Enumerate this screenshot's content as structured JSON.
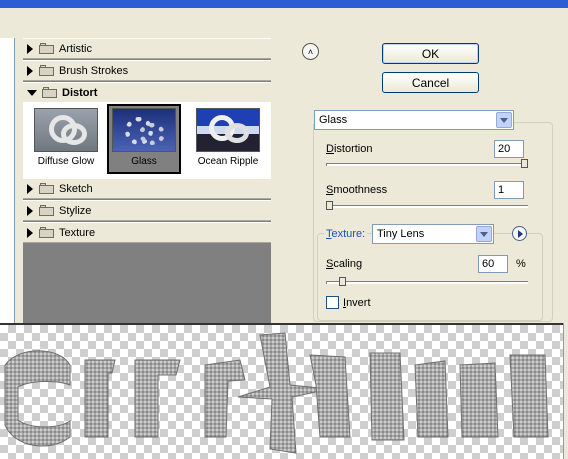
{
  "filter_categories_top": [
    {
      "label": "Artistic",
      "expanded": false
    },
    {
      "label": "Brush Strokes",
      "expanded": false
    },
    {
      "label": "Distort",
      "expanded": true
    }
  ],
  "distort_filters": [
    {
      "label": "Diffuse Glow",
      "selected": false
    },
    {
      "label": "Glass",
      "selected": true
    },
    {
      "label": "Ocean Ripple",
      "selected": false
    }
  ],
  "filter_categories_bottom": [
    {
      "label": "Sketch"
    },
    {
      "label": "Stylize"
    },
    {
      "label": "Texture"
    }
  ],
  "buttons": {
    "ok": "OK",
    "cancel": "Cancel"
  },
  "filter_select": {
    "value": "Glass"
  },
  "distortion": {
    "label": "Distortion",
    "mnemonic": "D",
    "rest": "istortion",
    "value": "20",
    "level": 20,
    "max": 20
  },
  "smoothness": {
    "label": "Smoothness",
    "mnemonic": "S",
    "rest": "moothness",
    "value": "1",
    "level": 1,
    "max": 15
  },
  "texture": {
    "label": "Texture:",
    "mnemonic": "T",
    "rest": "exture:",
    "value": "Tiny Lens"
  },
  "scaling": {
    "label": "Scaling",
    "mnemonic": "S",
    "rest": "caling",
    "value": "60",
    "unit": "%",
    "level": 60,
    "min": 50,
    "max": 200
  },
  "invert": {
    "label": "Invert",
    "mnemonic": "I",
    "rest": "nvert",
    "checked": false
  },
  "colors": {
    "selection": "#808080",
    "accent": "#1c52b4",
    "panel": "#ece9d8"
  },
  "icons": {
    "expand": "triangle-right-icon",
    "collapse": "triangle-down-icon",
    "folder": "folder-icon",
    "panel_toggle": "chevron-up-icon",
    "texture_menu": "arrow-right-icon"
  }
}
